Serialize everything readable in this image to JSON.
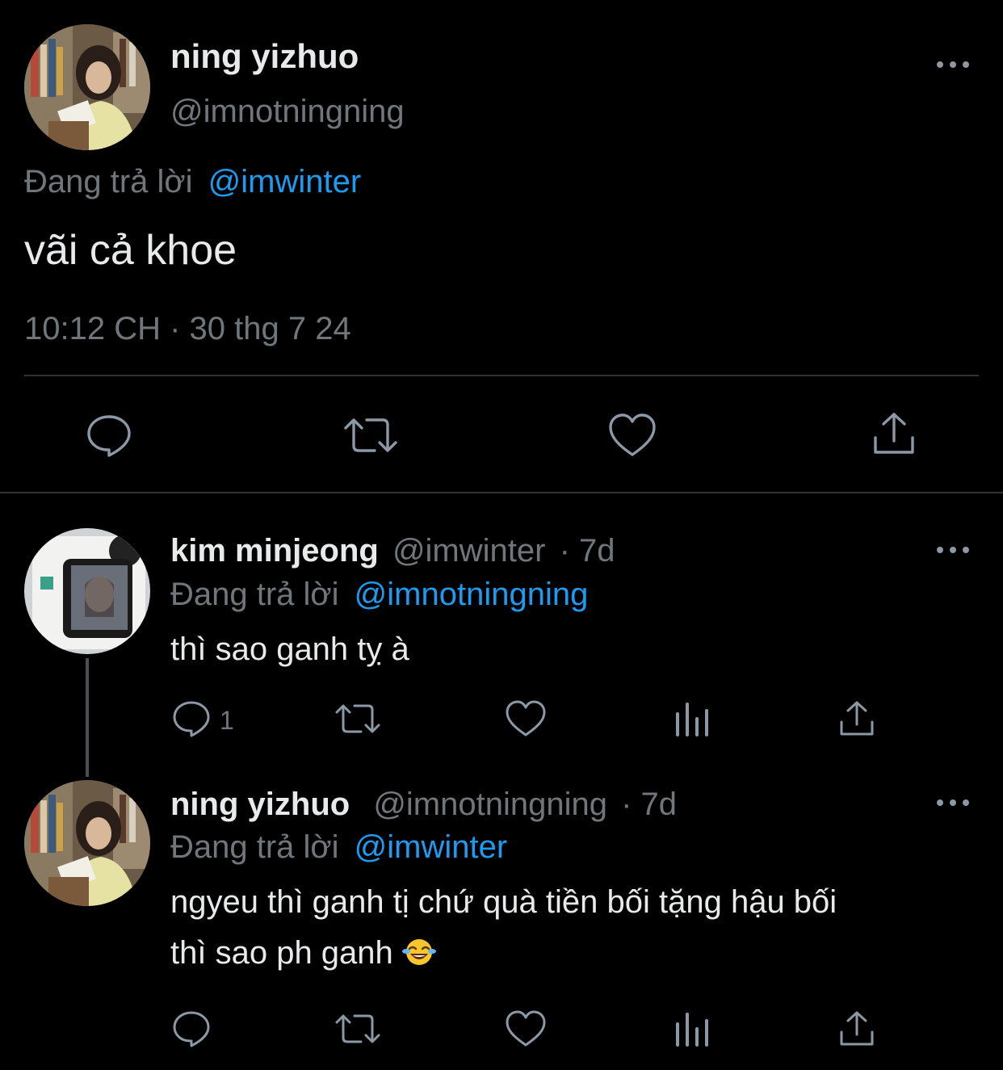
{
  "main_tweet": {
    "display_name": "ning yizhuo",
    "handle": "@imnotningning",
    "replying_prefix": "Đang trả lời",
    "replying_to": "@imwinter",
    "text": "vãi cả khoe",
    "timestamp": "10:12 CH · 30 thg 7 24",
    "actions": [
      "reply-icon",
      "retweet-icon",
      "like-icon",
      "share-icon"
    ]
  },
  "replies": [
    {
      "display_name": "kim minjeong",
      "handle": "@imwinter",
      "age": "· 7d",
      "replying_prefix": "Đang trả lời",
      "replying_to": "@imnotningning",
      "text": "thì sao ganh tỵ à",
      "reply_count": "1"
    },
    {
      "display_name": "ning yizhuo",
      "handle": "@imnotningning",
      "age": "· 7d",
      "replying_prefix": "Đang trả lời",
      "replying_to": "@imwinter",
      "text_line1": "ngyeu thì ganh tị chứ quà tiền bối tặng hậu bối",
      "text_line2": "thì sao ph ganh",
      "emoji": "face-with-tears-of-joy-icon"
    }
  ],
  "colors": {
    "background": "#000000",
    "text": "#e7e9ea",
    "muted": "#71767b",
    "link": "#1d9bf0",
    "icon": "#8b98a5",
    "divider": "#2f3336"
  }
}
